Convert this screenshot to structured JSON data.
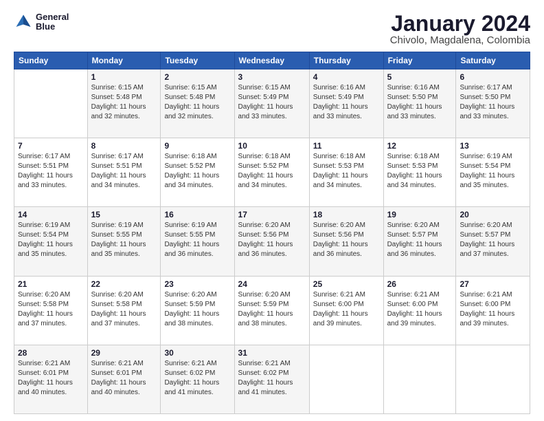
{
  "header": {
    "logo_line1": "General",
    "logo_line2": "Blue",
    "title": "January 2024",
    "subtitle": "Chivolo, Magdalena, Colombia"
  },
  "columns": [
    "Sunday",
    "Monday",
    "Tuesday",
    "Wednesday",
    "Thursday",
    "Friday",
    "Saturday"
  ],
  "weeks": [
    [
      {
        "day": "",
        "info": ""
      },
      {
        "day": "1",
        "info": "Sunrise: 6:15 AM\nSunset: 5:48 PM\nDaylight: 11 hours\nand 32 minutes."
      },
      {
        "day": "2",
        "info": "Sunrise: 6:15 AM\nSunset: 5:48 PM\nDaylight: 11 hours\nand 32 minutes."
      },
      {
        "day": "3",
        "info": "Sunrise: 6:15 AM\nSunset: 5:49 PM\nDaylight: 11 hours\nand 33 minutes."
      },
      {
        "day": "4",
        "info": "Sunrise: 6:16 AM\nSunset: 5:49 PM\nDaylight: 11 hours\nand 33 minutes."
      },
      {
        "day": "5",
        "info": "Sunrise: 6:16 AM\nSunset: 5:50 PM\nDaylight: 11 hours\nand 33 minutes."
      },
      {
        "day": "6",
        "info": "Sunrise: 6:17 AM\nSunset: 5:50 PM\nDaylight: 11 hours\nand 33 minutes."
      }
    ],
    [
      {
        "day": "7",
        "info": "Sunrise: 6:17 AM\nSunset: 5:51 PM\nDaylight: 11 hours\nand 33 minutes."
      },
      {
        "day": "8",
        "info": "Sunrise: 6:17 AM\nSunset: 5:51 PM\nDaylight: 11 hours\nand 34 minutes."
      },
      {
        "day": "9",
        "info": "Sunrise: 6:18 AM\nSunset: 5:52 PM\nDaylight: 11 hours\nand 34 minutes."
      },
      {
        "day": "10",
        "info": "Sunrise: 6:18 AM\nSunset: 5:52 PM\nDaylight: 11 hours\nand 34 minutes."
      },
      {
        "day": "11",
        "info": "Sunrise: 6:18 AM\nSunset: 5:53 PM\nDaylight: 11 hours\nand 34 minutes."
      },
      {
        "day": "12",
        "info": "Sunrise: 6:18 AM\nSunset: 5:53 PM\nDaylight: 11 hours\nand 34 minutes."
      },
      {
        "day": "13",
        "info": "Sunrise: 6:19 AM\nSunset: 5:54 PM\nDaylight: 11 hours\nand 35 minutes."
      }
    ],
    [
      {
        "day": "14",
        "info": "Sunrise: 6:19 AM\nSunset: 5:54 PM\nDaylight: 11 hours\nand 35 minutes."
      },
      {
        "day": "15",
        "info": "Sunrise: 6:19 AM\nSunset: 5:55 PM\nDaylight: 11 hours\nand 35 minutes."
      },
      {
        "day": "16",
        "info": "Sunrise: 6:19 AM\nSunset: 5:55 PM\nDaylight: 11 hours\nand 36 minutes."
      },
      {
        "day": "17",
        "info": "Sunrise: 6:20 AM\nSunset: 5:56 PM\nDaylight: 11 hours\nand 36 minutes."
      },
      {
        "day": "18",
        "info": "Sunrise: 6:20 AM\nSunset: 5:56 PM\nDaylight: 11 hours\nand 36 minutes."
      },
      {
        "day": "19",
        "info": "Sunrise: 6:20 AM\nSunset: 5:57 PM\nDaylight: 11 hours\nand 36 minutes."
      },
      {
        "day": "20",
        "info": "Sunrise: 6:20 AM\nSunset: 5:57 PM\nDaylight: 11 hours\nand 37 minutes."
      }
    ],
    [
      {
        "day": "21",
        "info": "Sunrise: 6:20 AM\nSunset: 5:58 PM\nDaylight: 11 hours\nand 37 minutes."
      },
      {
        "day": "22",
        "info": "Sunrise: 6:20 AM\nSunset: 5:58 PM\nDaylight: 11 hours\nand 37 minutes."
      },
      {
        "day": "23",
        "info": "Sunrise: 6:20 AM\nSunset: 5:59 PM\nDaylight: 11 hours\nand 38 minutes."
      },
      {
        "day": "24",
        "info": "Sunrise: 6:20 AM\nSunset: 5:59 PM\nDaylight: 11 hours\nand 38 minutes."
      },
      {
        "day": "25",
        "info": "Sunrise: 6:21 AM\nSunset: 6:00 PM\nDaylight: 11 hours\nand 39 minutes."
      },
      {
        "day": "26",
        "info": "Sunrise: 6:21 AM\nSunset: 6:00 PM\nDaylight: 11 hours\nand 39 minutes."
      },
      {
        "day": "27",
        "info": "Sunrise: 6:21 AM\nSunset: 6:00 PM\nDaylight: 11 hours\nand 39 minutes."
      }
    ],
    [
      {
        "day": "28",
        "info": "Sunrise: 6:21 AM\nSunset: 6:01 PM\nDaylight: 11 hours\nand 40 minutes."
      },
      {
        "day": "29",
        "info": "Sunrise: 6:21 AM\nSunset: 6:01 PM\nDaylight: 11 hours\nand 40 minutes."
      },
      {
        "day": "30",
        "info": "Sunrise: 6:21 AM\nSunset: 6:02 PM\nDaylight: 11 hours\nand 41 minutes."
      },
      {
        "day": "31",
        "info": "Sunrise: 6:21 AM\nSunset: 6:02 PM\nDaylight: 11 hours\nand 41 minutes."
      },
      {
        "day": "",
        "info": ""
      },
      {
        "day": "",
        "info": ""
      },
      {
        "day": "",
        "info": ""
      }
    ]
  ]
}
